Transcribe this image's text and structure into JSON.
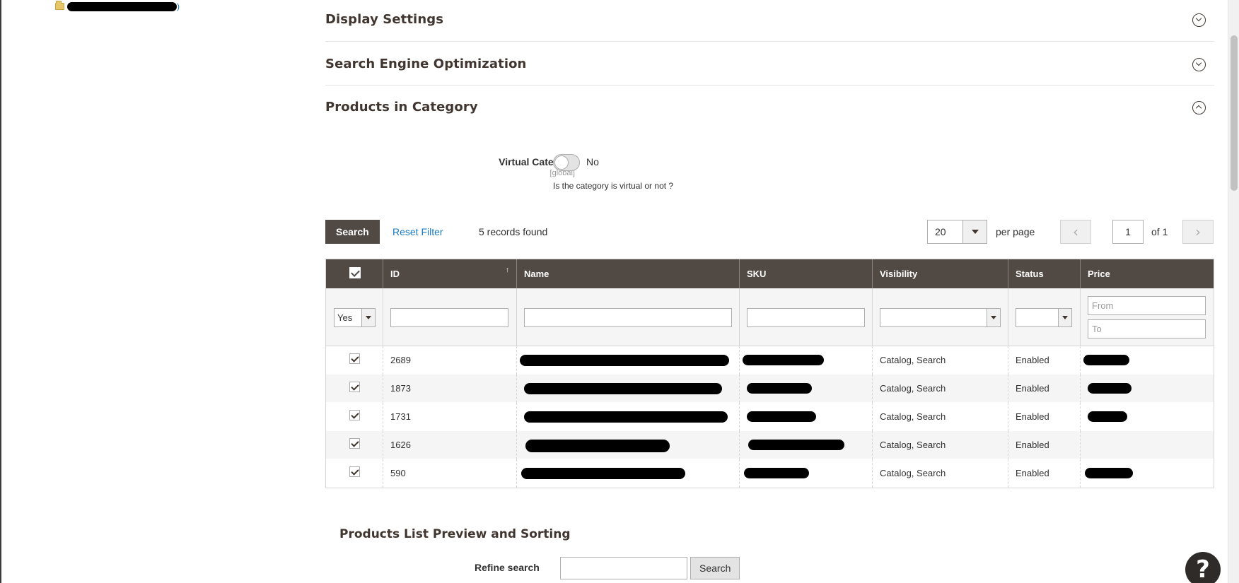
{
  "sections": {
    "display_settings": "Display Settings",
    "seo": "Search Engine Optimization",
    "products_in_category": "Products in Category"
  },
  "virtual_category": {
    "label": "Virtual Category",
    "scope": "[global]",
    "value": "No",
    "note": "Is the category is virtual or not ?"
  },
  "toolbar": {
    "search_label": "Search",
    "reset_label": "Reset Filter",
    "records": "5 records found",
    "per_page_value": "20",
    "per_page_label": "per page",
    "prev": "‹",
    "next": "›",
    "page": "1",
    "of": "of 1"
  },
  "grid": {
    "columns": [
      "ID",
      "Name",
      "SKU",
      "Visibility",
      "Status",
      "Price"
    ],
    "sort_indicator": "↑",
    "filters": {
      "in_category": "Yes",
      "price_from_placeholder": "From",
      "price_to_placeholder": "To"
    },
    "rows": [
      {
        "id": "2689",
        "visibility": "Catalog, Search",
        "status": "Enabled"
      },
      {
        "id": "1873",
        "visibility": "Catalog, Search",
        "status": "Enabled"
      },
      {
        "id": "1731",
        "visibility": "Catalog, Search",
        "status": "Enabled"
      },
      {
        "id": "1626",
        "visibility": "Catalog, Search",
        "status": "Enabled"
      },
      {
        "id": "590",
        "visibility": "Catalog, Search",
        "status": "Enabled"
      }
    ]
  },
  "preview": {
    "title": "Products List Preview and Sorting",
    "refine_label": "Refine search",
    "search_button": "Search"
  },
  "help": "?",
  "tree": {
    "suffix": ")"
  }
}
